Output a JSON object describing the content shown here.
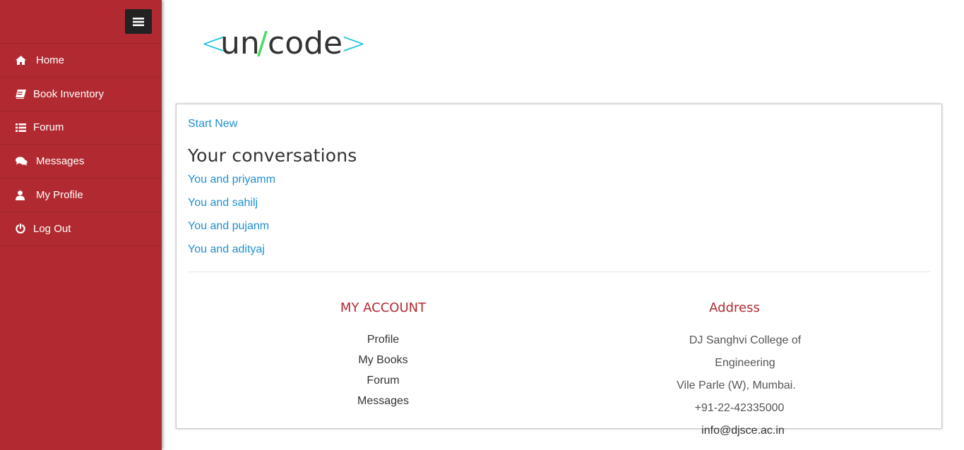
{
  "logo": {
    "left": "<",
    "main1": "un",
    "slash": "/",
    "main2": "code",
    "right": ">"
  },
  "sidebar": {
    "items": [
      {
        "label": "Home",
        "icon": "home-icon"
      },
      {
        "label": "Book Inventory",
        "icon": "book-icon"
      },
      {
        "label": "Forum",
        "icon": "list-icon"
      },
      {
        "label": "Messages",
        "icon": "comments-icon"
      },
      {
        "label": "My Profile",
        "icon": "user-icon"
      },
      {
        "label": "Log Out",
        "icon": "power-icon"
      }
    ]
  },
  "main": {
    "start_new": "Start New",
    "title": "Your conversations",
    "conversations": [
      "You and priyamm",
      "You and sahilj",
      "You and pujanm",
      "You and adityaj"
    ]
  },
  "footer": {
    "account": {
      "heading": "MY ACCOUNT",
      "links": [
        "Profile",
        "My Books",
        "Forum",
        "Messages"
      ]
    },
    "address": {
      "heading": "Address",
      "lines": [
        "DJ Sanghvi College of Engineering",
        "Vile Parle (W), Mumbai.",
        "+91-22-42335000"
      ],
      "email": "info@djsce.ac.in"
    }
  },
  "colors": {
    "sidebar": "#b22a31",
    "link": "#1e8fd1",
    "logo_bracket": "#26c6da",
    "logo_slash": "#4cd964"
  }
}
